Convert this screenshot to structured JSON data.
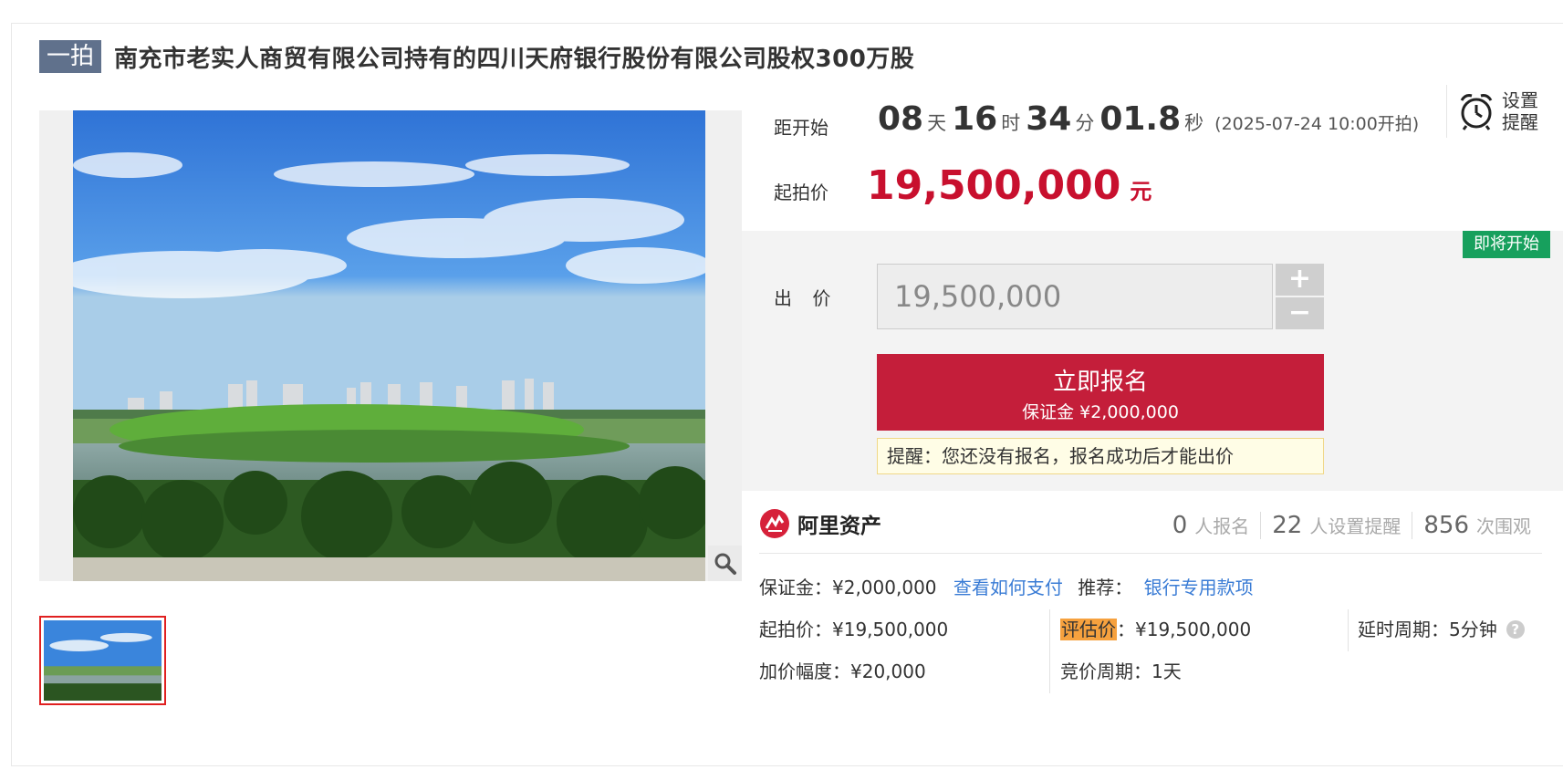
{
  "title": {
    "round_tag": "一拍",
    "text": "南充市老实人商贸有限公司持有的四川天府银行股份有限公司股权300万股"
  },
  "countdown": {
    "label": "距开始",
    "days": "08",
    "days_unit": "天",
    "hours": "16",
    "hours_unit": "时",
    "minutes": "34",
    "minutes_unit": "分",
    "seconds": "01.8",
    "seconds_unit": "秒",
    "start_text": "(2025-07-24 10:00开拍)"
  },
  "reminder": {
    "label": "设置提醒",
    "icon": "alarm-clock-icon"
  },
  "start_price": {
    "label": "起拍价",
    "value": "19,500,000",
    "unit": "元"
  },
  "bid": {
    "status_badge": "即将开始",
    "label": "出 价",
    "input_value": "19,500,000",
    "plus": "+",
    "minus": "−",
    "signup_label": "立即报名",
    "signup_deposit": "保证金 ¥2,000,000",
    "notice": "提醒：您还没有报名，报名成功后才能出价"
  },
  "platform": {
    "name": "阿里资产",
    "icon": "ali-assets-logo-icon"
  },
  "stats": [
    {
      "count": "0",
      "label": "人报名"
    },
    {
      "count": "22",
      "label": "人设置提醒"
    },
    {
      "count": "856",
      "label": "次围观"
    }
  ],
  "details": {
    "deposit_label": "保证金：",
    "deposit_value": "¥2,000,000",
    "pay_link": "查看如何支付",
    "recommend_label": "推荐：",
    "recommend_link": "银行专用款项",
    "start_price_label": "起拍价：",
    "start_price_value": "¥19,500,000",
    "appraisal_label": "评估价",
    "appraisal_value": "：¥19,500,000",
    "extension_label": "延时周期：",
    "extension_value": "5分钟",
    "increment_label": "加价幅度：",
    "increment_value": "¥20,000",
    "bidding_period_label": "竞价周期：",
    "bidding_period_value": "1天"
  },
  "colors": {
    "accent_red": "#c41e3a",
    "price_red": "#c8102e",
    "badge_green": "#17a05d",
    "link_blue": "#3a7cd5",
    "highlight_orange": "#f6a13e",
    "tag_slate": "#60718c"
  },
  "icons": {
    "zoom": "magnifier-icon",
    "help": "question-mark-icon"
  }
}
